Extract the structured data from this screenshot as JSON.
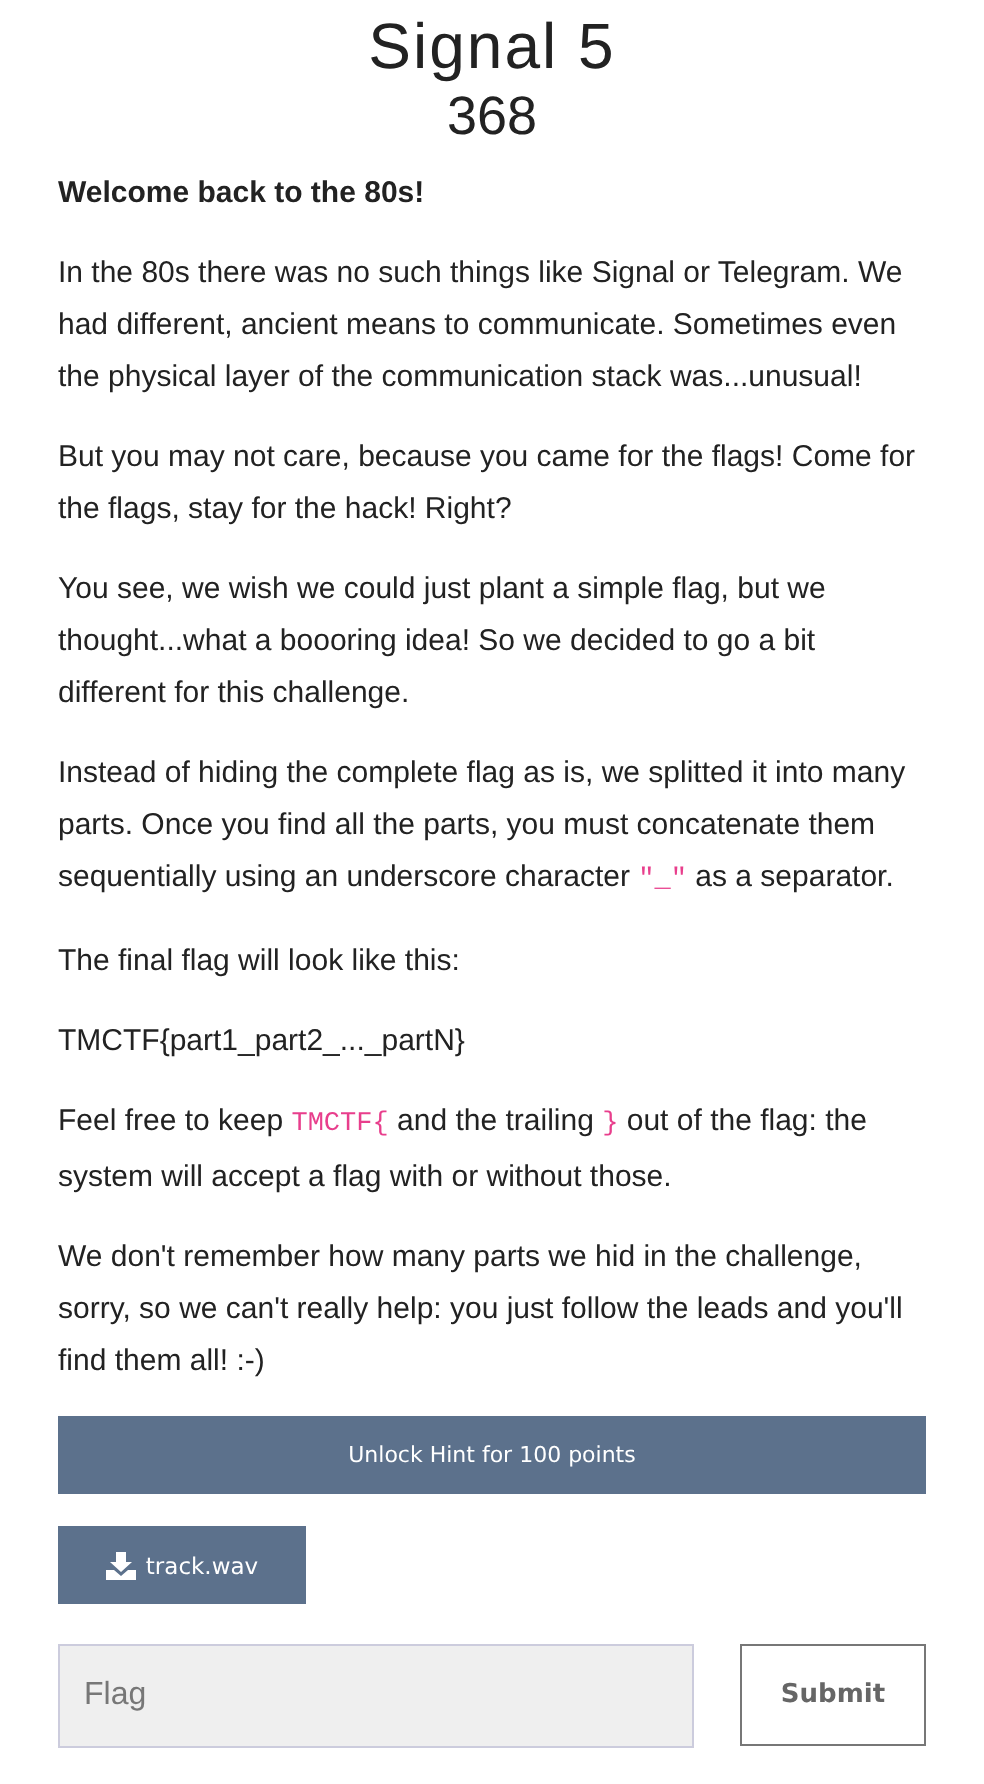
{
  "title": "Signal 5",
  "points": "368",
  "paragraphs": [
    [
      {
        "kind": "bold",
        "text": "Welcome back to the 80s!"
      }
    ],
    [
      {
        "kind": "text",
        "text": "In the 80s there was no such things like Signal or Telegram. We had different, ancient means to communicate. Sometimes even the physical layer of the communication stack was...unusual!"
      }
    ],
    [
      {
        "kind": "text",
        "text": "But you may not care, because you came for the flags! Come for the flags, stay for the hack! Right?"
      }
    ],
    [
      {
        "kind": "text",
        "text": "You see, we wish we could just plant a simple flag, but we thought...what a boooring idea! So we decided to go a bit different for this challenge."
      }
    ],
    [
      {
        "kind": "text",
        "text": "Instead of hiding the complete flag as is, we splitted it into many parts. Once you find all the parts, you must concatenate them sequentially using an underscore character "
      },
      {
        "kind": "code",
        "text": "\"_\""
      },
      {
        "kind": "text",
        "text": " as a separator."
      }
    ],
    [
      {
        "kind": "text",
        "text": "The final flag will look like this:"
      }
    ],
    [
      {
        "kind": "text",
        "text": "TMCTF{part1_part2_..._partN}"
      }
    ],
    [
      {
        "kind": "text",
        "text": "Feel free to keep "
      },
      {
        "kind": "code",
        "text": "TMCTF{"
      },
      {
        "kind": "text",
        "text": " and the trailing "
      },
      {
        "kind": "code",
        "text": "}"
      },
      {
        "kind": "text",
        "text": " out of the flag: the system will accept a flag with or without those."
      }
    ],
    [
      {
        "kind": "text",
        "text": "We don't remember how many parts we hid in the challenge, sorry, so we can't really help: you just follow the leads and you'll find them all! :-)"
      }
    ]
  ],
  "hint_button": "Unlock Hint for 100 points",
  "file_button": "track.wav",
  "flag_field": {
    "placeholder": "Flag"
  },
  "submit_button": "Submit"
}
